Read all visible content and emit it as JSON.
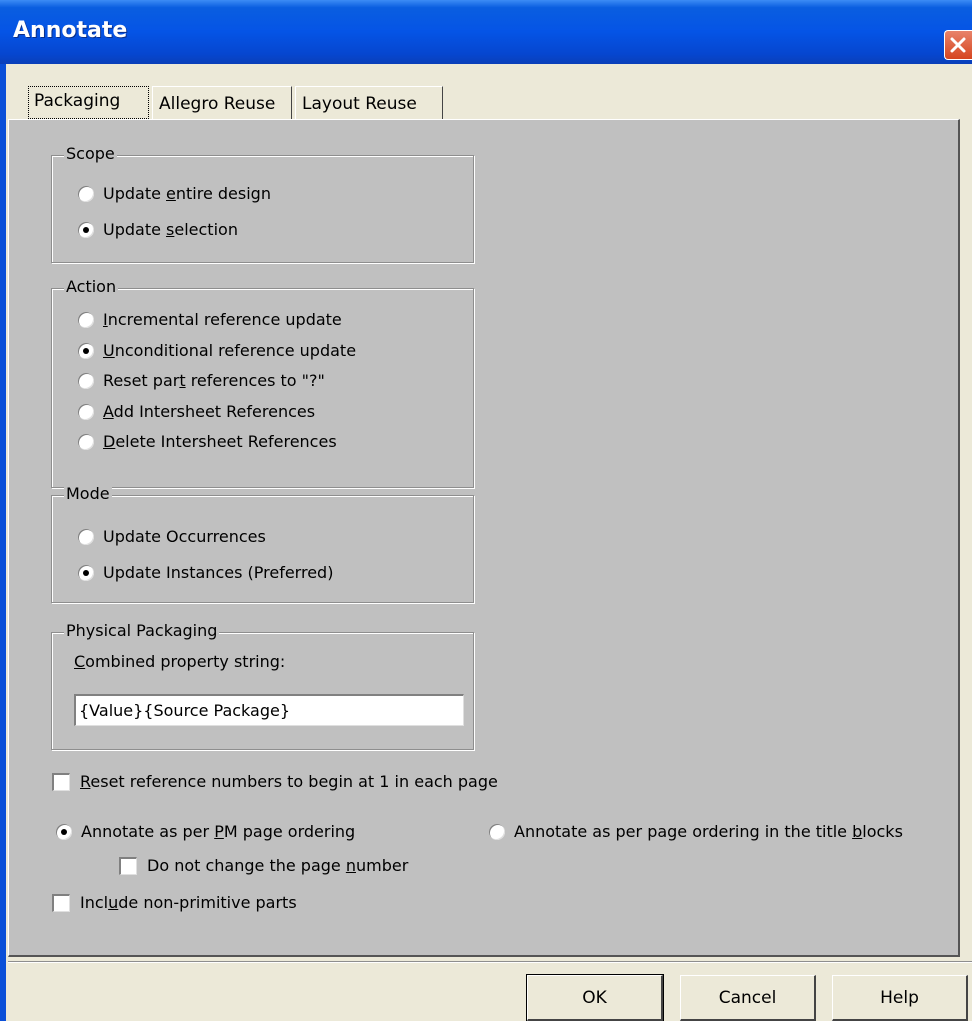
{
  "window": {
    "title": "Annotate"
  },
  "tabs": [
    {
      "label": "Packaging",
      "active": true
    },
    {
      "label": "Allegro Reuse",
      "active": false
    },
    {
      "label": "Layout Reuse",
      "active": false
    }
  ],
  "scope": {
    "legend": "Scope",
    "options": [
      {
        "pre": "Update ",
        "u": "e",
        "post": "ntire design",
        "selected": false
      },
      {
        "pre": "Update ",
        "u": "s",
        "post": "election",
        "selected": true
      }
    ]
  },
  "action": {
    "legend": "Action",
    "options": [
      {
        "pre": "",
        "u": "I",
        "post": "ncremental reference update",
        "selected": false
      },
      {
        "pre": "",
        "u": "U",
        "post": "nconditional reference update",
        "selected": true
      },
      {
        "pre": "Reset par",
        "u": "t",
        "post": " references to \"?\"",
        "selected": false
      },
      {
        "pre": "",
        "u": "A",
        "post": "dd Intersheet References",
        "selected": false
      },
      {
        "pre": "",
        "u": "D",
        "post": "elete Intersheet References",
        "selected": false
      }
    ]
  },
  "mode": {
    "legend": "Mode",
    "options": [
      {
        "pre": "Update Occurrences",
        "u": "",
        "post": "",
        "selected": false
      },
      {
        "pre": "Update Instances (Preferred)",
        "u": "",
        "post": "",
        "selected": true
      }
    ]
  },
  "physical": {
    "legend": "Physical Packaging",
    "field_label_u": "C",
    "field_label_rest": "ombined property string:",
    "field_value": "{Value}{Source Package}"
  },
  "reset_refs": {
    "u": "R",
    "post": "eset reference numbers to begin at 1 in each page",
    "checked": false
  },
  "ordering": {
    "pm": {
      "pre": "Annotate as per ",
      "u": "P",
      "post": "M page ordering",
      "selected": true
    },
    "title": {
      "pre": "Annotate as per page ordering in the title ",
      "u": "b",
      "post": "locks",
      "selected": false
    }
  },
  "no_change_page": {
    "pre": "Do not change the page ",
    "u": "n",
    "post": "umber",
    "checked": false
  },
  "non_primitive": {
    "pre": "Incl",
    "u": "u",
    "post": "de non-primitive parts",
    "checked": false
  },
  "buttons": {
    "ok": "OK",
    "cancel": "Cancel",
    "help": "Help"
  }
}
